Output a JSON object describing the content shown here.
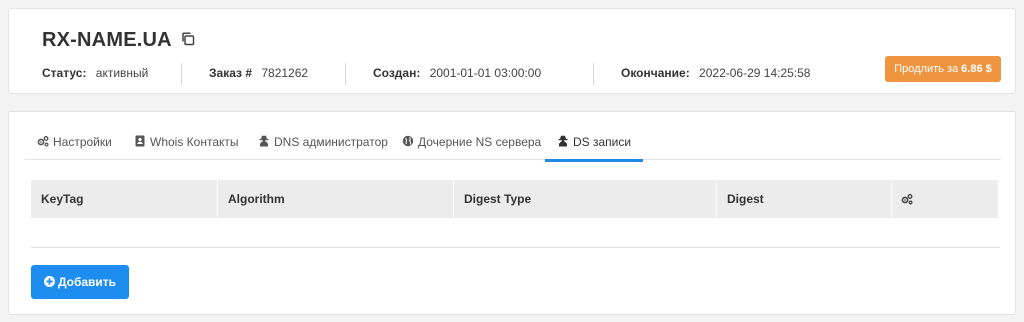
{
  "domain": {
    "name": "RX-NAME.UA"
  },
  "info": {
    "status_label": "Статус:",
    "status_value": "активный",
    "order_label": "Заказ #",
    "order_value": "7821262",
    "created_label": "Создан:",
    "created_value": "2001-01-01 03:00:00",
    "expires_label": "Окончание:",
    "expires_value": "2022-06-29 14:25:58"
  },
  "renew": {
    "label": "Продлить за",
    "price": "6.86 $"
  },
  "tabs": [
    {
      "label": "Настройки",
      "icon": "gears-icon"
    },
    {
      "label": "Whois Контакты",
      "icon": "address-book-icon"
    },
    {
      "label": "DNS администратор",
      "icon": "user-secret-icon"
    },
    {
      "label": "Дочерние NS сервера",
      "icon": "globe-icon"
    },
    {
      "label": "DS записи",
      "icon": "user-secret-icon",
      "active": true
    }
  ],
  "table": {
    "columns": [
      "KeyTag",
      "Algorithm",
      "Digest Type",
      "Digest"
    ],
    "actions_icon": "gears-icon",
    "rows": []
  },
  "add_button": {
    "label": "Добавить",
    "icon": "plus-circle-icon"
  },
  "colors": {
    "accent": "#1e8df0",
    "renew": "#f0953f",
    "tab_underline": "#1e88e5"
  }
}
